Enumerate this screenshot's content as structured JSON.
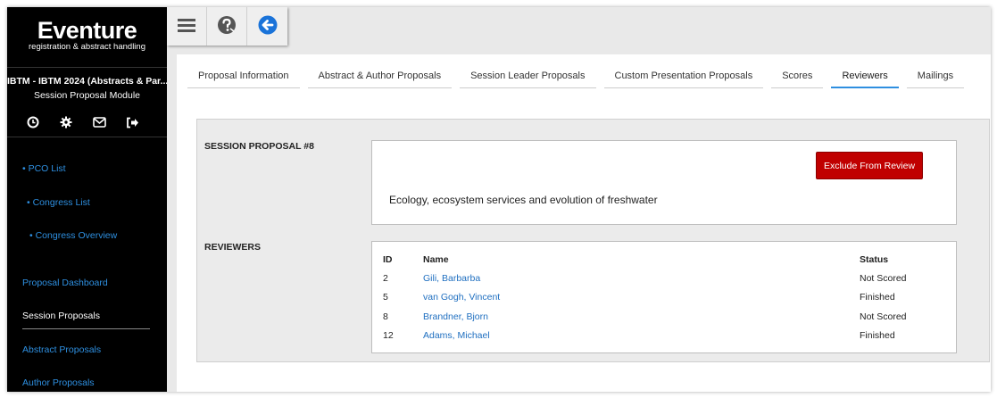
{
  "brand": {
    "name": "Eventure",
    "tagline": "registration & abstract handling"
  },
  "sidebar": {
    "congress": "IBTM - IBTM 2024 (Abstracts & Par...",
    "module": "Session Proposal Module",
    "icons": [
      "clock-icon",
      "gear-icon",
      "mail-icon",
      "logout-icon"
    ],
    "links": [
      {
        "label": "• PCO List"
      },
      {
        "label": "• Congress List"
      },
      {
        "label": "• Congress Overview"
      },
      {
        "label": "Proposal Dashboard"
      },
      {
        "label": "Session Proposals"
      },
      {
        "label": "Abstract Proposals"
      },
      {
        "label": "Author Proposals"
      }
    ],
    "active_link": "Session Proposals"
  },
  "toolbar": {
    "icons": [
      "hamburger-menu-icon",
      "help-icon",
      "back-arrow-icon"
    ]
  },
  "tabs": [
    {
      "label": "Proposal Information"
    },
    {
      "label": "Abstract & Author Proposals"
    },
    {
      "label": "Session Leader Proposals"
    },
    {
      "label": "Custom Presentation Proposals"
    },
    {
      "label": "Scores"
    },
    {
      "label": "Reviewers"
    },
    {
      "label": "Mailings"
    }
  ],
  "active_tab": "Reviewers",
  "proposal": {
    "section_label": "SESSION PROPOSAL #8",
    "exclude_button": "Exclude From Review",
    "title": "Ecology, ecosystem services and evolution of freshwater"
  },
  "reviewers": {
    "section_label": "REVIEWERS",
    "columns": {
      "id": "ID",
      "name": "Name",
      "status": "Status"
    },
    "rows": [
      {
        "id": "2",
        "name": "Gili, Barbarba",
        "status": "Not Scored"
      },
      {
        "id": "5",
        "name": "van Gogh, Vincent",
        "status": "Finished"
      },
      {
        "id": "8",
        "name": "Brandner, Bjorn",
        "status": "Not Scored"
      },
      {
        "id": "12",
        "name": "Adams, Michael",
        "status": "Finished"
      }
    ]
  },
  "colors": {
    "accent": "#2e8fe0",
    "danger": "#c00000",
    "sidebar_bg": "#000000",
    "link": "#1f6fc0"
  }
}
